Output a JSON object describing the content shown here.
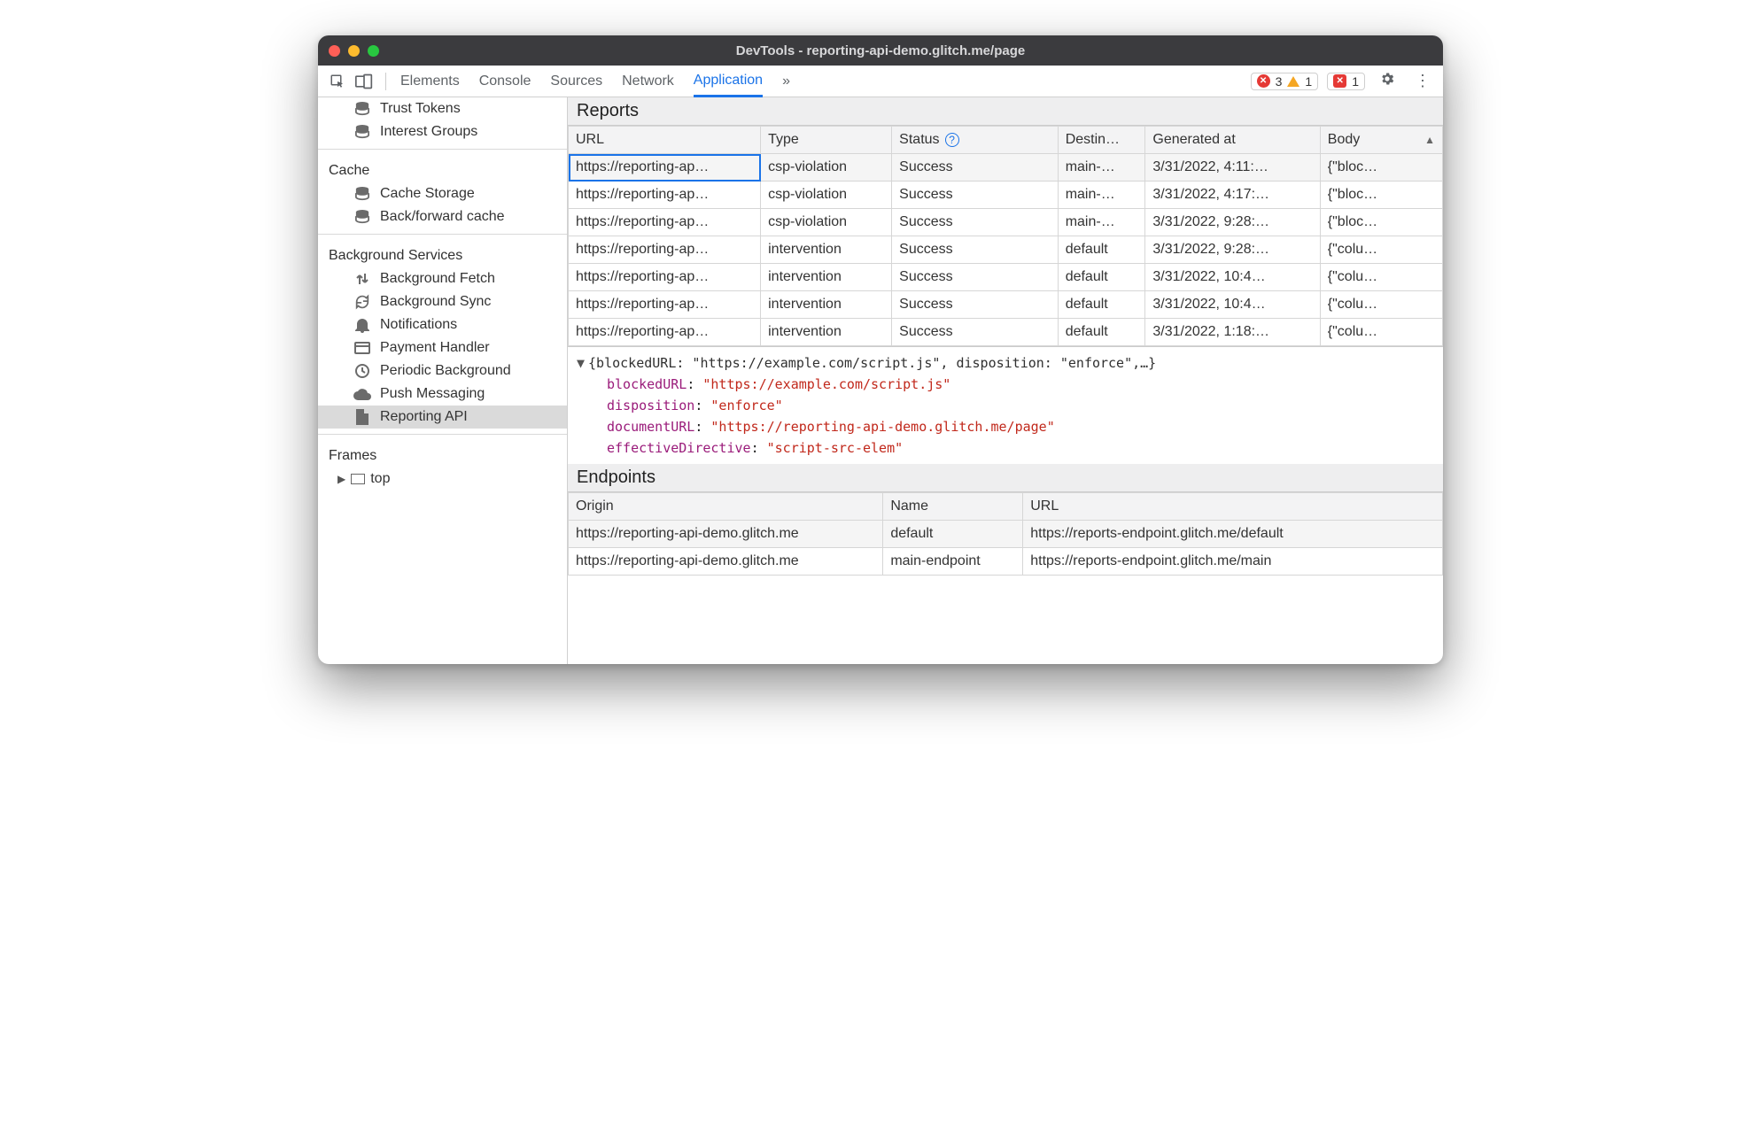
{
  "window": {
    "title": "DevTools - reporting-api-demo.glitch.me/page"
  },
  "toolbar": {
    "tabs": [
      "Elements",
      "Console",
      "Sources",
      "Network",
      "Application"
    ],
    "active_tab": "Application",
    "errors": "3",
    "warnings": "1",
    "issues": "1"
  },
  "sidebar": {
    "leading_items": [
      {
        "label": "Trust Tokens",
        "icon": "database"
      },
      {
        "label": "Interest Groups",
        "icon": "database"
      }
    ],
    "groups": [
      {
        "title": "Cache",
        "items": [
          {
            "label": "Cache Storage",
            "icon": "database"
          },
          {
            "label": "Back/forward cache",
            "icon": "database"
          }
        ]
      },
      {
        "title": "Background Services",
        "items": [
          {
            "label": "Background Fetch",
            "icon": "transfer"
          },
          {
            "label": "Background Sync",
            "icon": "sync"
          },
          {
            "label": "Notifications",
            "icon": "bell"
          },
          {
            "label": "Payment Handler",
            "icon": "card"
          },
          {
            "label": "Periodic Background",
            "icon": "clock"
          },
          {
            "label": "Push Messaging",
            "icon": "cloud"
          },
          {
            "label": "Reporting API",
            "icon": "file",
            "selected": true
          }
        ]
      }
    ],
    "frames": {
      "title": "Frames",
      "top": "top"
    }
  },
  "reports": {
    "title": "Reports",
    "columns": [
      "URL",
      "Type",
      "Status",
      "Destin…",
      "Generated at",
      "Body"
    ],
    "rows": [
      {
        "url": "https://reporting-ap…",
        "type": "csp-violation",
        "status": "Success",
        "dest": "main-…",
        "gen": "3/31/2022, 4:11:…",
        "body": "{\"bloc…"
      },
      {
        "url": "https://reporting-ap…",
        "type": "csp-violation",
        "status": "Success",
        "dest": "main-…",
        "gen": "3/31/2022, 4:17:…",
        "body": "{\"bloc…"
      },
      {
        "url": "https://reporting-ap…",
        "type": "csp-violation",
        "status": "Success",
        "dest": "main-…",
        "gen": "3/31/2022, 9:28:…",
        "body": "{\"bloc…"
      },
      {
        "url": "https://reporting-ap…",
        "type": "intervention",
        "status": "Success",
        "dest": "default",
        "gen": "3/31/2022, 9:28:…",
        "body": "{\"colu…"
      },
      {
        "url": "https://reporting-ap…",
        "type": "intervention",
        "status": "Success",
        "dest": "default",
        "gen": "3/31/2022, 10:4…",
        "body": "{\"colu…"
      },
      {
        "url": "https://reporting-ap…",
        "type": "intervention",
        "status": "Success",
        "dest": "default",
        "gen": "3/31/2022, 10:4…",
        "body": "{\"colu…"
      },
      {
        "url": "https://reporting-ap…",
        "type": "intervention",
        "status": "Success",
        "dest": "default",
        "gen": "3/31/2022, 1:18:…",
        "body": "{\"colu…"
      }
    ]
  },
  "detail": {
    "summary": "{blockedURL: \"https://example.com/script.js\", disposition: \"enforce\",…}",
    "props": [
      {
        "k": "blockedURL",
        "v": "\"https://example.com/script.js\""
      },
      {
        "k": "disposition",
        "v": "\"enforce\""
      },
      {
        "k": "documentURL",
        "v": "\"https://reporting-api-demo.glitch.me/page\""
      },
      {
        "k": "effectiveDirective",
        "v": "\"script-src-elem\""
      }
    ]
  },
  "endpoints": {
    "title": "Endpoints",
    "columns": [
      "Origin",
      "Name",
      "URL"
    ],
    "rows": [
      {
        "origin": "https://reporting-api-demo.glitch.me",
        "name": "default",
        "url": "https://reports-endpoint.glitch.me/default"
      },
      {
        "origin": "https://reporting-api-demo.glitch.me",
        "name": "main-endpoint",
        "url": "https://reports-endpoint.glitch.me/main"
      }
    ]
  }
}
